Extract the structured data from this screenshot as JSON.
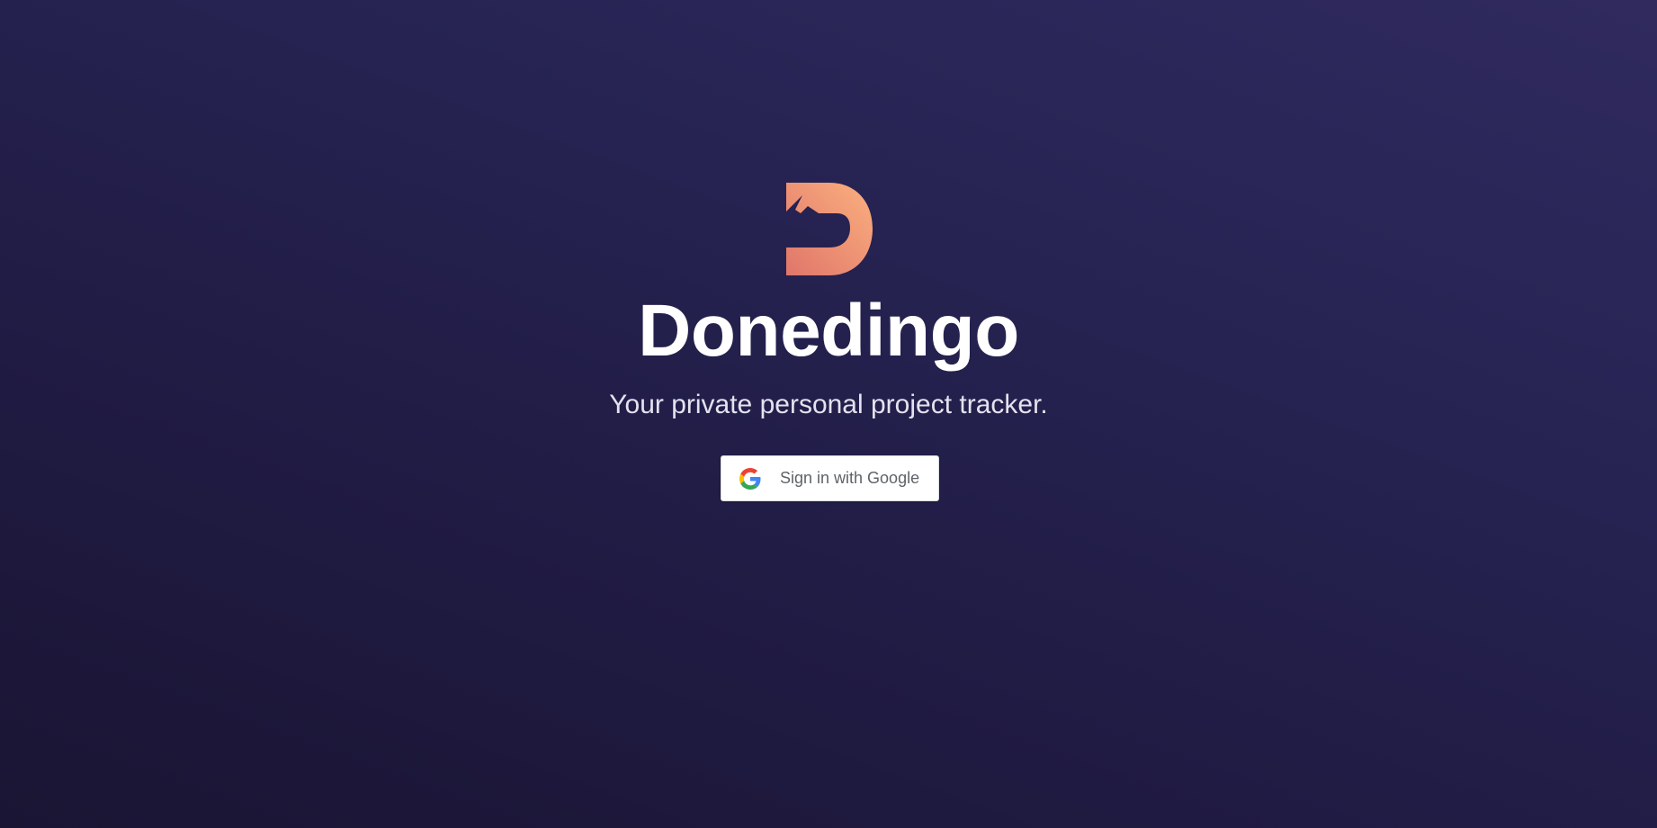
{
  "app": {
    "name": "Donedingo",
    "tagline": "Your private personal project tracker."
  },
  "auth": {
    "google_button_label": "Sign in with Google",
    "icon": "google-icon"
  },
  "colors": {
    "background_top": "#302a5f",
    "background_bottom": "#1a1533",
    "logo_gradient_start": "#fbb07f",
    "logo_gradient_end": "#e0766a",
    "title": "#ffffff",
    "tagline": "#e4e2ee"
  },
  "logo": {
    "icon": "dingo-d-logo-icon"
  }
}
